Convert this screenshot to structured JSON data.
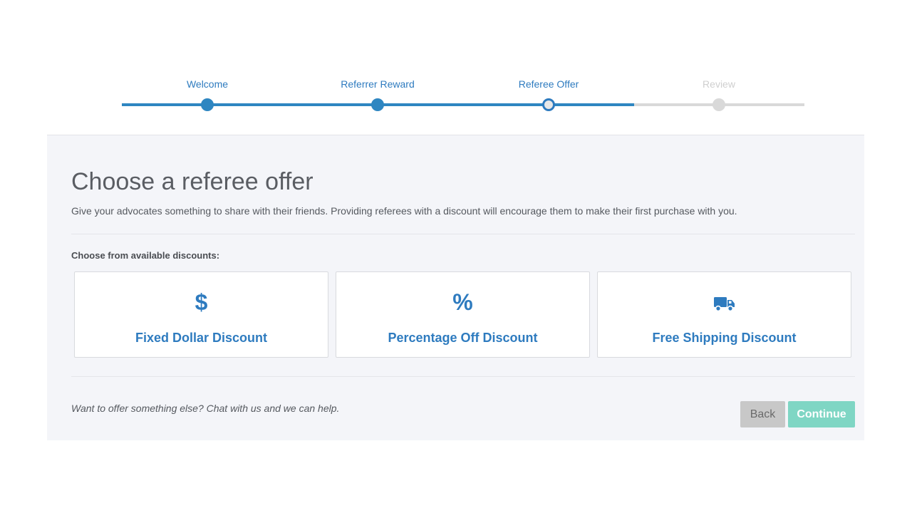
{
  "stepper": {
    "progress_percent": 75,
    "steps": [
      {
        "label": "Welcome",
        "state": "complete"
      },
      {
        "label": "Referrer Reward",
        "state": "complete"
      },
      {
        "label": "Referee Offer",
        "state": "current"
      },
      {
        "label": "Review",
        "state": "pending"
      }
    ]
  },
  "main": {
    "title": "Choose a referee offer",
    "subtitle": "Give your advocates something to share with their friends. Providing referees with a discount will encourage them to make their first purchase with you.",
    "choose_label": "Choose from available discounts:",
    "options": [
      {
        "icon": "dollar-icon",
        "glyph": "$",
        "label": "Fixed Dollar Discount"
      },
      {
        "icon": "percent-icon",
        "glyph": "%",
        "label": "Percentage Off Discount"
      },
      {
        "icon": "truck-icon",
        "glyph": "",
        "label": "Free Shipping Discount"
      }
    ]
  },
  "footer": {
    "help_text": "Want to offer something else? Chat with us and we can help.",
    "back_label": "Back",
    "continue_label": "Continue"
  },
  "colors": {
    "accent": "#2e7bbf",
    "continue_button": "#7fd6c4",
    "back_button": "#c8c8c8",
    "panel_background": "#f4f5f9"
  }
}
